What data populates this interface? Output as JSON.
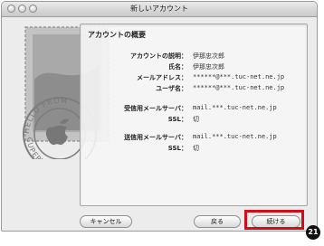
{
  "window": {
    "title": "新しいアカウント"
  },
  "summary": {
    "heading": "アカウントの概要",
    "rows": [
      {
        "label": "アカウントの説明：",
        "value": "伊那忠次郎"
      },
      {
        "label": "氏名：",
        "value": "伊那忠次郎"
      },
      {
        "label": "メールアドレス：",
        "value": "******@***.tuc-net.ne.jp"
      },
      {
        "label": "ユーザ名：",
        "value": "******@***.tuc-net.ne.jp"
      },
      {
        "label": "受信用メールサーバ：",
        "value": "mail.***.tuc-net.ne.jp"
      },
      {
        "label": "SSL：",
        "value": "切"
      },
      {
        "label": "送信用メールサーバ：",
        "value": "mail.***.tuc-net.ne.jp"
      },
      {
        "label": "SSL：",
        "value": "切"
      }
    ]
  },
  "stamp": {
    "text": "HELLO FROM CUPERTINO"
  },
  "buttons": {
    "cancel": "キャンセル",
    "back": "戻る",
    "continue": "続ける"
  },
  "annotation": {
    "step": "21",
    "highlight_color": "#d10d1a"
  }
}
